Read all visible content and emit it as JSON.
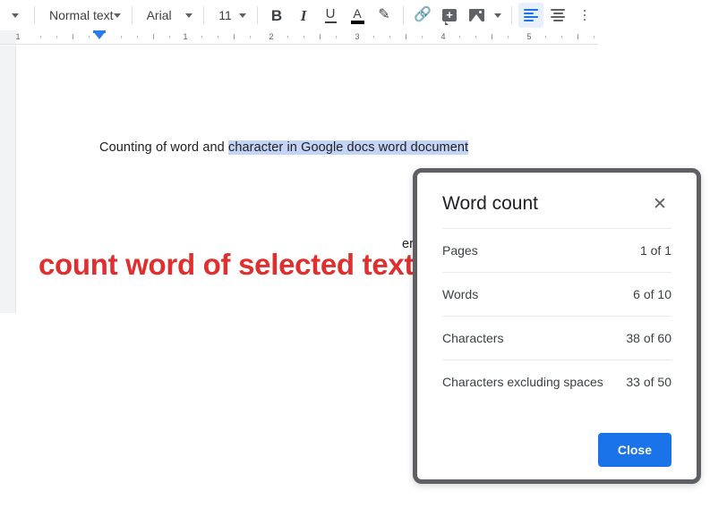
{
  "toolbar": {
    "zoom_caret_icon": "chevron-down-icon",
    "paragraph_style": {
      "label": "Normal text",
      "caret_icon": "chevron-down-icon"
    },
    "font_family": {
      "label": "Arial",
      "caret_icon": "chevron-down-icon"
    },
    "font_size": {
      "label": "11",
      "caret_icon": "chevron-down-icon"
    },
    "buttons": [
      {
        "name": "bold-button",
        "glyph": "B"
      },
      {
        "name": "italic-button",
        "glyph": "I"
      },
      {
        "name": "underline-button",
        "glyph": "U"
      },
      {
        "name": "text-color-button",
        "glyph": "A"
      },
      {
        "name": "highlight-color-button",
        "glyph": "✎"
      },
      {
        "name": "insert-link-button",
        "glyph": "🔗"
      },
      {
        "name": "add-comment-button",
        "glyph": "+"
      },
      {
        "name": "insert-image-button",
        "glyph": "image"
      },
      {
        "name": "align-left-button",
        "glyph": "align-left"
      },
      {
        "name": "align-center-button",
        "glyph": "align-center"
      },
      {
        "name": "line-spacing-button",
        "glyph": "more"
      }
    ]
  },
  "ruler": {
    "left_label": "1",
    "numbers": [
      "1",
      "2",
      "3",
      "4",
      "5"
    ]
  },
  "document": {
    "line_prefix": "Counting of word and ",
    "line_selected": "character in Google docs word document",
    "annotation": "count word of selected text",
    "occluded_text": "er"
  },
  "word_count_dialog": {
    "title": "Word count",
    "close_icon": "close-icon",
    "rows": [
      {
        "label": "Pages",
        "value": "1 of 1"
      },
      {
        "label": "Words",
        "value": "6 of 10"
      },
      {
        "label": "Characters",
        "value": "38 of 60"
      },
      {
        "label": "Characters excluding spaces",
        "value": "33 of 50"
      }
    ],
    "close_button": "Close"
  },
  "colors": {
    "accent_blue": "#1a73e8",
    "selection_blue": "#c3d4f7",
    "annotation_red": "#e02f2f",
    "toolbar_text": "#3c4043"
  }
}
